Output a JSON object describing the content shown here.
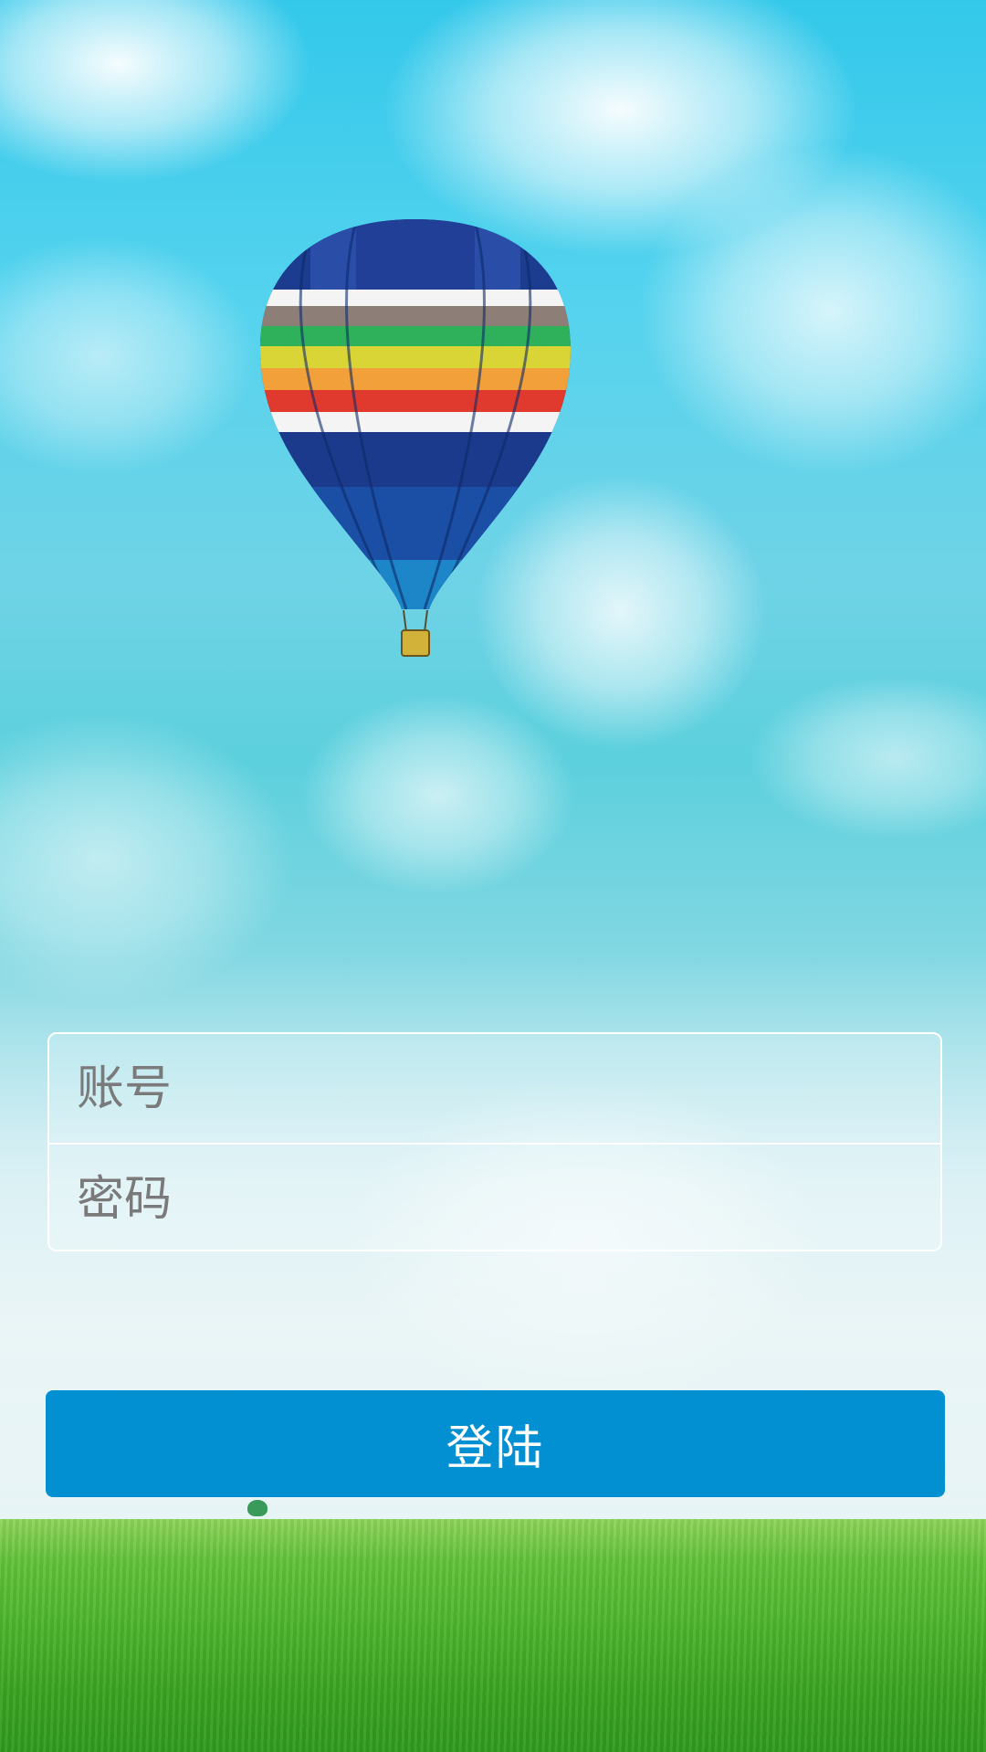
{
  "login_form": {
    "account_placeholder": "账号",
    "password_placeholder": "密码",
    "login_label": "登陆"
  },
  "colors": {
    "login_button": "#0290d3",
    "input_border": "#ffffff",
    "placeholder_text": "#7a7a7a"
  },
  "background": {
    "scene": "hot-air-balloon-over-grass-field"
  }
}
